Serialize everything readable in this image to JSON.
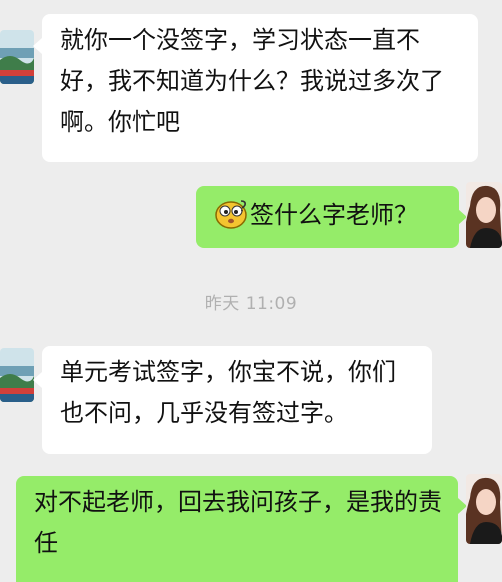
{
  "messages": [
    {
      "side": "incoming",
      "text": "就你一个没签字，学习状态一直不好，我不知道为什么？我说过多次了啊。你忙吧"
    },
    {
      "side": "outgoing",
      "emoji": "confused-face-emoji",
      "text": "签什么字老师？"
    },
    {
      "side": "incoming",
      "text": "单元考试签字，你宝不说，你们也不问，几乎没有签过字。"
    },
    {
      "side": "outgoing",
      "text": "对不起老师，回去我问孩子，是我的责任"
    }
  ],
  "timestamp": "昨天 11:09",
  "colors": {
    "background": "#ededed",
    "incoming_bubble": "#ffffff",
    "outgoing_bubble": "#95ec69",
    "timestamp_text": "#b0b0b0"
  },
  "icons": {
    "teacher_avatar": "landscape-avatar",
    "parent_avatar": "portrait-avatar"
  }
}
